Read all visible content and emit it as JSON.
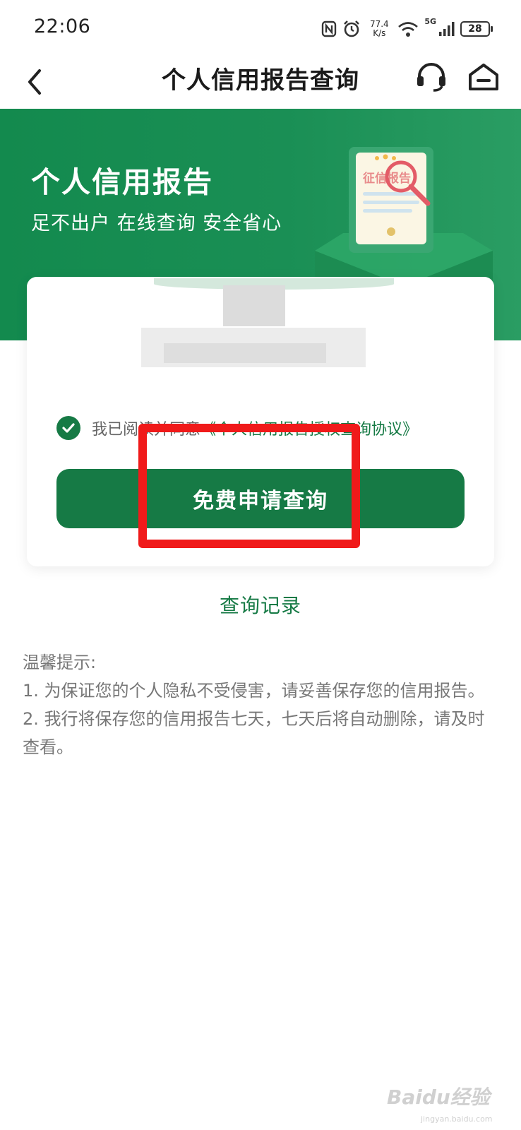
{
  "status_bar": {
    "time": "22:06",
    "net_speed_value": "77.4",
    "net_speed_unit": "K/s",
    "signal_label": "5G",
    "battery": "28",
    "icons": [
      "nfc-icon",
      "alarm-icon",
      "wifi-icon",
      "signal-icon",
      "battery-icon"
    ]
  },
  "nav": {
    "title": "个人信用报告查询",
    "back_icon": "chevron-left-icon",
    "service_icon": "headset-icon",
    "home_icon": "home-icon"
  },
  "banner": {
    "title": "个人信用报告",
    "subtitle": "足不出户 在线查询 安全省心",
    "illustration_text": "征信报告"
  },
  "card": {
    "agree_prefix": "我已阅读并同意",
    "agree_link": "《个人信用报告授权查询协议》",
    "apply_button": "免费申请查询"
  },
  "records_link": "查询记录",
  "tips": {
    "title": "温馨提示:",
    "items": [
      "1. 为保证您的个人隐私不受侵害，请妥善保存您的信用报告。",
      "2. 我行将保存您的信用报告七天，七天后将自动删除，请及时查看。"
    ]
  },
  "watermark": {
    "text": "Baidu经验",
    "sub": "jingyan.baidu.com"
  },
  "colors": {
    "brand_green": "#167a45",
    "banner_green": "#1a8f55",
    "highlight_red": "#f01a1a"
  }
}
